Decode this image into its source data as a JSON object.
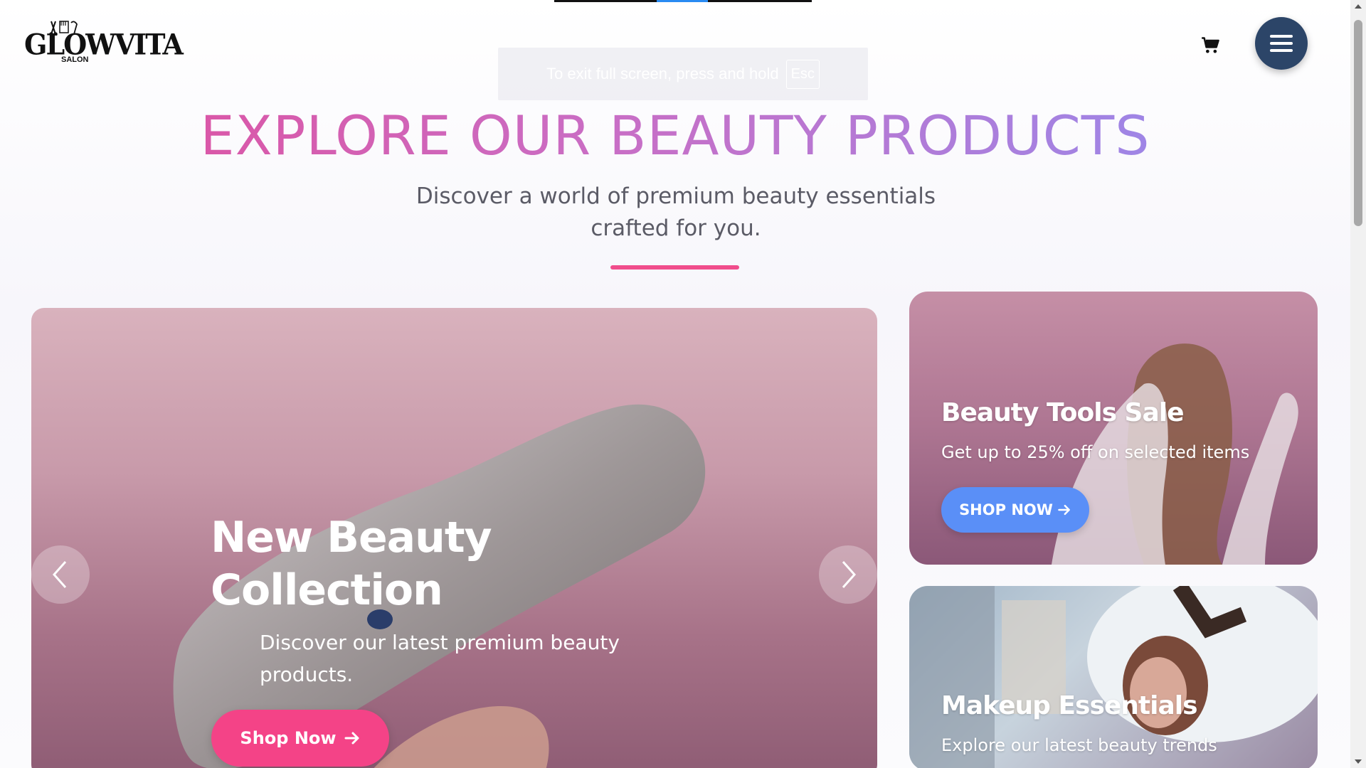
{
  "brand": {
    "logo_text": "GLOWVITA",
    "logo_sub": "SALON"
  },
  "fullscreen_notice": {
    "text": "To exit full screen, press and hold",
    "key": "Esc"
  },
  "header": {
    "cart_icon": "cart-icon",
    "menu_icon": "hamburger-icon"
  },
  "hero": {
    "title": "EXPLORE OUR BEAUTY PRODUCTS",
    "subtitle": "Discover a world of premium beauty essentials crafted for you."
  },
  "slider": {
    "title": "New Beauty Collection",
    "description": "Discover our latest premium beauty products.",
    "button_label": "Shop Now",
    "prev_icon": "chevron-left-icon",
    "next_icon": "chevron-right-icon"
  },
  "cards": [
    {
      "title": "Beauty Tools Sale",
      "description": "Get up to 25% off on selected items",
      "button_label": "SHOP NOW"
    },
    {
      "title": "Makeup Essentials",
      "description": "Explore our latest beauty trends"
    }
  ],
  "colors": {
    "accent_pink": "#f44387",
    "accent_blue": "#5a8ff7",
    "menu_navy": "#2c4568",
    "title_gradient": [
      "#e24d9a",
      "#c96ec5",
      "#8f8ef2"
    ]
  }
}
